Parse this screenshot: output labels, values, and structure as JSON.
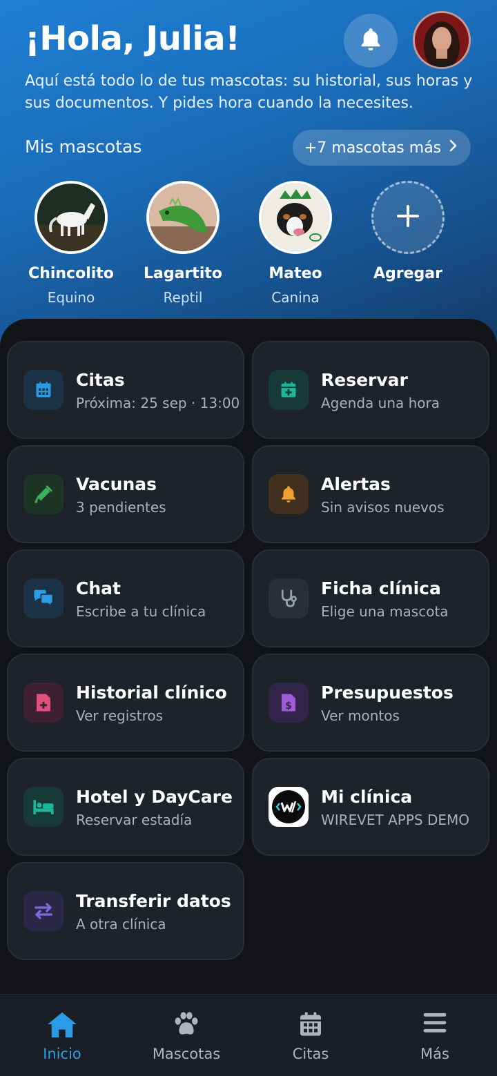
{
  "header": {
    "greeting": "¡Hola, Julia!",
    "subtitle": "Aquí está todo lo de tus mascotas: su historial, sus horas y sus documentos. Y pides hora cuando la necesites."
  },
  "pets_section": {
    "label": "Mis mascotas",
    "more_button": "+7 mascotas más",
    "pets": [
      {
        "name": "Chincolito",
        "type": "Equino"
      },
      {
        "name": "Lagartito",
        "type": "Reptil"
      },
      {
        "name": "Mateo",
        "type": "Canina"
      }
    ],
    "add_label": "Agregar"
  },
  "cards": [
    {
      "title": "Citas",
      "subtitle": "Próxima: 25 sep · 13:00",
      "icon": "calendar-icon",
      "color": "#2b9be6"
    },
    {
      "title": "Reservar",
      "subtitle": "Agenda una hora",
      "icon": "calendar-plus-icon",
      "color": "#1fb59a"
    },
    {
      "title": "Vacunas",
      "subtitle": "3 pendientes",
      "icon": "syringe-icon",
      "color": "#3fae5a"
    },
    {
      "title": "Alertas",
      "subtitle": "Sin avisos nuevos",
      "icon": "bell-icon",
      "color": "#f0a030"
    },
    {
      "title": "Chat",
      "subtitle": "Escribe a tu clínica",
      "icon": "chat-icon",
      "color": "#2b9be6"
    },
    {
      "title": "Ficha clínica",
      "subtitle": "Elige una mascota",
      "icon": "stethoscope-icon",
      "color": "#9aa2ad"
    },
    {
      "title": "Historial clínico",
      "subtitle": "Ver registros",
      "icon": "medical-file-icon",
      "color": "#e0507a"
    },
    {
      "title": "Presupuestos",
      "subtitle": "Ver montos",
      "icon": "invoice-icon",
      "color": "#a05ad6"
    },
    {
      "title": "Hotel y DayCare",
      "subtitle": "Reservar estadía",
      "icon": "bed-icon",
      "color": "#1fb59a"
    },
    {
      "title": "Mi clínica",
      "subtitle": "WIREVET APPS DEMO",
      "icon": "clinic-logo-icon",
      "color": "#ffffff"
    },
    {
      "title": "Transferir datos",
      "subtitle": "A otra clínica",
      "icon": "transfer-icon",
      "color": "#7b6ae0"
    }
  ],
  "nav": [
    {
      "label": "Inicio",
      "icon": "home-icon",
      "active": true
    },
    {
      "label": "Mascotas",
      "icon": "paw-icon",
      "active": false
    },
    {
      "label": "Citas",
      "icon": "calendar-icon",
      "active": false
    },
    {
      "label": "Más",
      "icon": "menu-icon",
      "active": false
    }
  ],
  "colors": {
    "accent": "#2b9be6",
    "card_bg": "#1e2229",
    "page_bg": "#121418"
  }
}
